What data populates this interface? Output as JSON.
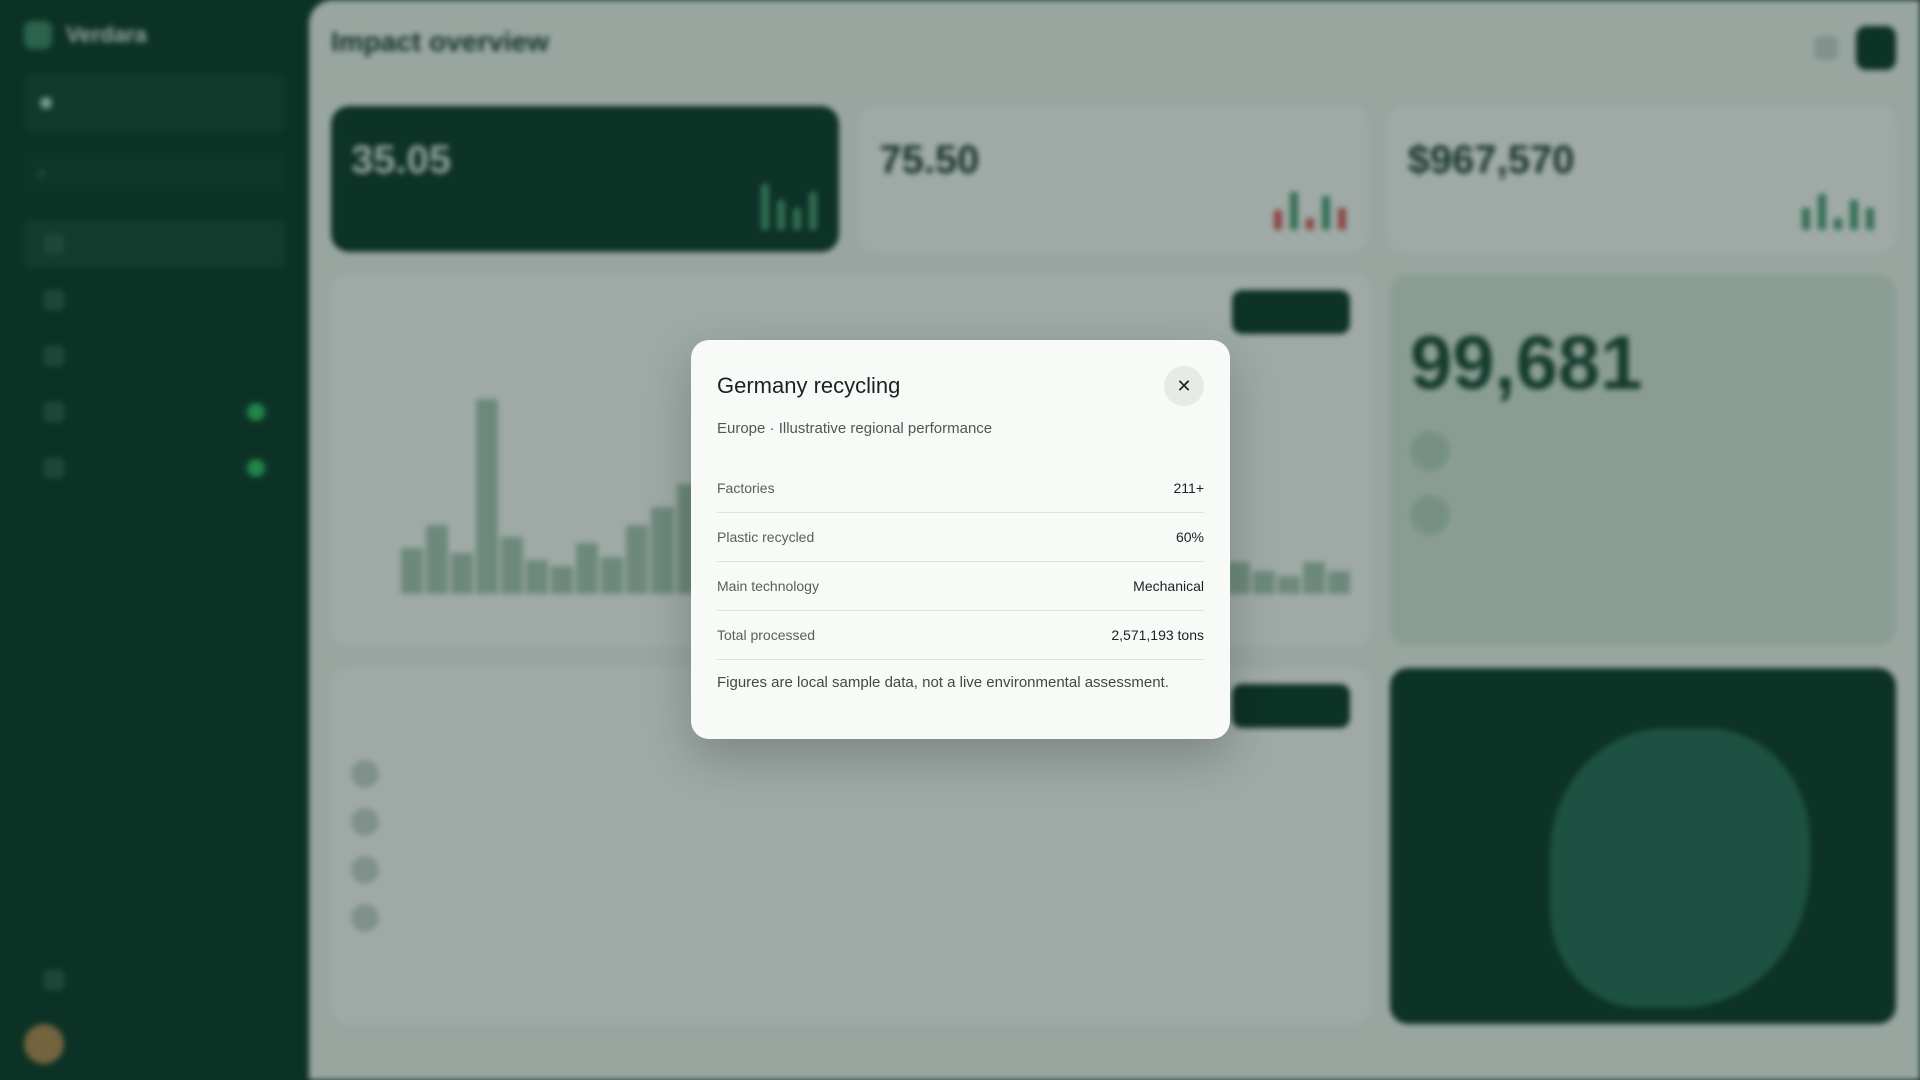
{
  "background": {
    "brand": "Verdara",
    "page_title": "Impact overview",
    "kpis": [
      {
        "value": "35.05"
      },
      {
        "value": "75.50"
      },
      {
        "value": "$967,570"
      }
    ],
    "emissions_value": "99,681"
  },
  "modal": {
    "title": "Germany recycling",
    "close_glyph": "✕",
    "subtitle": "Europe · Illustrative regional performance",
    "rows": [
      {
        "label": "Factories",
        "value": "211+"
      },
      {
        "label": "Plastic recycled",
        "value": "60%"
      },
      {
        "label": "Main technology",
        "value": "Mechanical"
      },
      {
        "label": "Total processed",
        "value": "2,571,193 tons"
      }
    ],
    "note": "Figures are local sample data, not a live environmental assessment."
  }
}
